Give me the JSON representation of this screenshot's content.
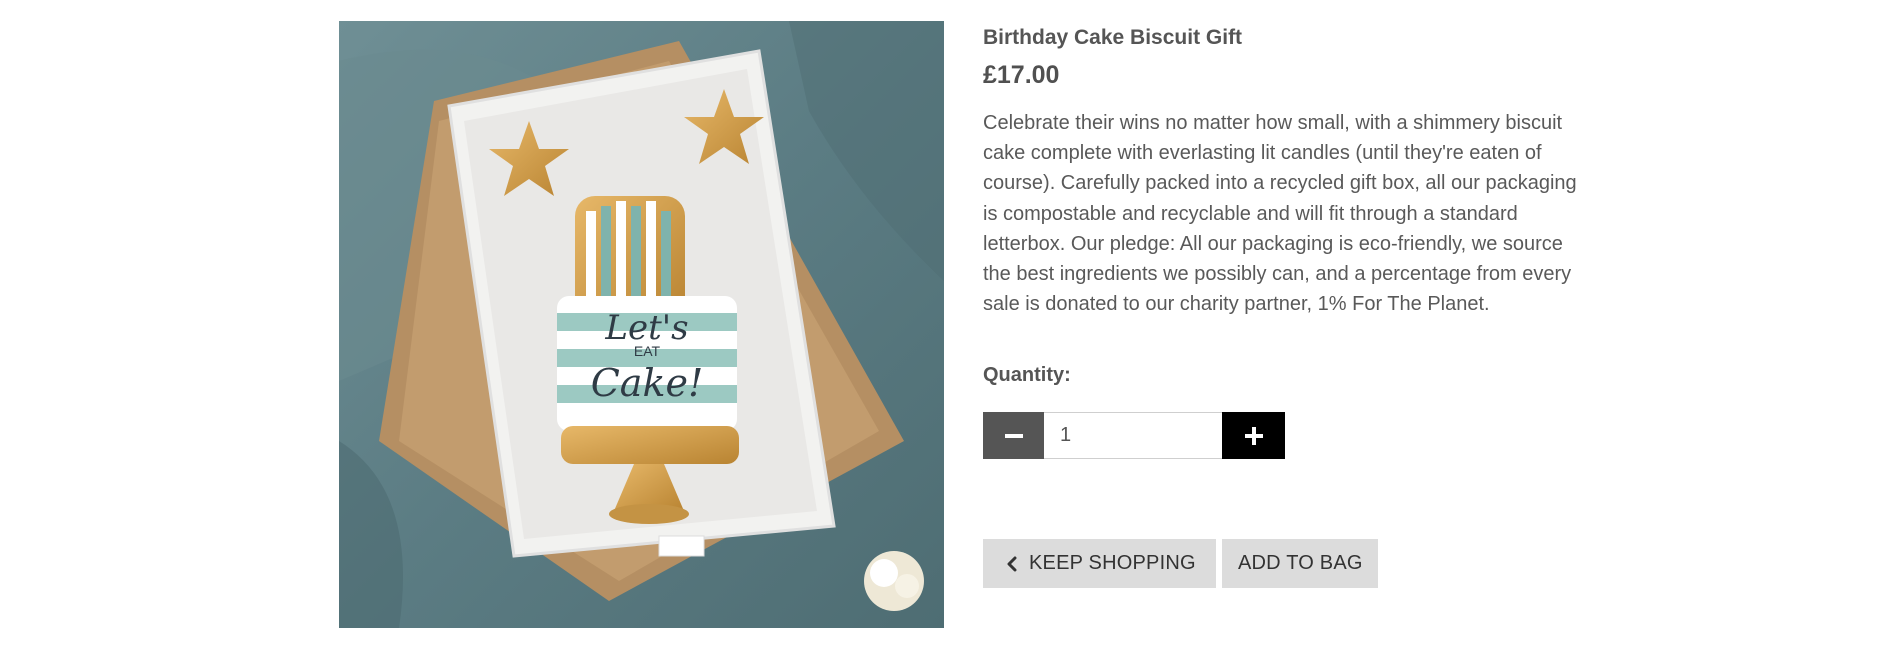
{
  "product": {
    "title": "Birthday Cake Biscuit Gift",
    "price": "£17.00",
    "description": "Celebrate their wins no matter how small, with a shimmery biscuit cake complete with everlasting lit candles (until they're eaten of course). Carefully packed into a recycled gift box, all our packaging is compostable and recyclable and will fit through a standard letterbox. Our pledge: All our packaging is eco-friendly, we source the best ingredients we possibly can, and a percentage from every sale is donated to our charity partner, 1% For The Planet.",
    "image_text": {
      "line1": "Let's",
      "line2": "EAT",
      "line3": "Cake!"
    }
  },
  "quantity": {
    "label": "Quantity:",
    "value": "1",
    "minus_icon": "minus-icon",
    "plus_icon": "plus-icon"
  },
  "actions": {
    "keep_shopping": "KEEP SHOPPING",
    "keep_shopping_icon": "chevron-left-icon",
    "add_to_bag": "ADD TO BAG"
  },
  "colors": {
    "minus_button": "#555555",
    "plus_button": "#000000",
    "action_button": "#dcdcdc"
  }
}
